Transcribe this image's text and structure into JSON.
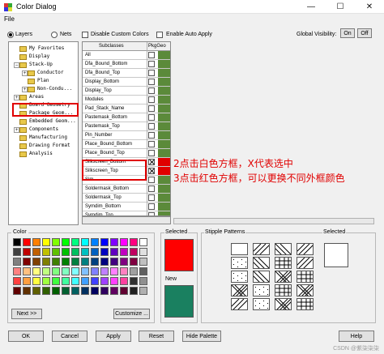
{
  "window": {
    "title": "Color Dialog",
    "min": "—",
    "max": "☐",
    "close": "✕"
  },
  "menu": {
    "file": "File"
  },
  "options": {
    "layers": "Layers",
    "nets": "Nets",
    "disable_custom_colors": "Disable Custom Colors",
    "enable_auto_apply": "Enable Auto Apply",
    "global_visibility": "Global Visibility:",
    "on": "On",
    "off": "Off"
  },
  "tree": [
    {
      "label": "My Favorites",
      "depth": 1,
      "expander": ""
    },
    {
      "label": "Display",
      "depth": 1,
      "expander": ""
    },
    {
      "label": "Stack-Up",
      "depth": 1,
      "expander": "−"
    },
    {
      "label": "Conductor",
      "depth": 2,
      "expander": "+"
    },
    {
      "label": "Plan",
      "depth": 2,
      "expander": ""
    },
    {
      "label": "Non-Condu...",
      "depth": 2,
      "expander": "+"
    },
    {
      "label": "Areas",
      "depth": 1,
      "expander": "+"
    },
    {
      "label": "Board Geometry",
      "depth": 1,
      "expander": ""
    },
    {
      "label": "Package Geom...",
      "depth": 1,
      "expander": ""
    },
    {
      "label": "Embedded Geom...",
      "depth": 1,
      "expander": ""
    },
    {
      "label": "Components",
      "depth": 1,
      "expander": "+"
    },
    {
      "label": "Manufacturing",
      "depth": 1,
      "expander": ""
    },
    {
      "label": "Drawing Format",
      "depth": 1,
      "expander": ""
    },
    {
      "label": "Analysis",
      "depth": 1,
      "expander": ""
    }
  ],
  "subclasses": {
    "col_name": "Subclasses",
    "col_pkg": "PkgGeo",
    "rows": [
      {
        "name": "All",
        "checked": false,
        "color": "#5b8a3a"
      },
      {
        "name": "Dfa_Bound_Bottom",
        "checked": false,
        "color": "#5b8a3a"
      },
      {
        "name": "Dfa_Bound_Top",
        "checked": false,
        "color": "#5b8a3a"
      },
      {
        "name": "Display_Bottom",
        "checked": false,
        "color": "#5b8a3a"
      },
      {
        "name": "Display_Top",
        "checked": false,
        "color": "#5b8a3a"
      },
      {
        "name": "Modules",
        "checked": false,
        "color": "#5b8a3a"
      },
      {
        "name": "Pad_Stack_Name",
        "checked": false,
        "color": "#5b8a3a"
      },
      {
        "name": "Pastemask_Bottom",
        "checked": false,
        "color": "#5b8a3a"
      },
      {
        "name": "Pastemask_Top",
        "checked": false,
        "color": "#5b8a3a"
      },
      {
        "name": "Pin_Number",
        "checked": false,
        "color": "#5b8a3a"
      },
      {
        "name": "Place_Bound_Bottom",
        "checked": false,
        "color": "#5b8a3a"
      },
      {
        "name": "Place_Bound_Top",
        "checked": false,
        "color": "#5b8a3a"
      },
      {
        "name": "Silkscreen_Bottom",
        "checked": true,
        "color": "#e00000"
      },
      {
        "name": "Silkscreen_Top",
        "checked": true,
        "color": "#e00000"
      },
      {
        "name": "Sim",
        "checked": false,
        "color": "#5b8a3a"
      },
      {
        "name": "Soldermask_Bottom",
        "checked": false,
        "color": "#5b8a3a"
      },
      {
        "name": "Soldermask_Top",
        "checked": false,
        "color": "#5b8a3a"
      },
      {
        "name": "Symdim_Bottom",
        "checked": false,
        "color": "#5b8a3a"
      },
      {
        "name": "Symdim_Top",
        "checked": false,
        "color": "#5b8a3a"
      }
    ]
  },
  "annotations": {
    "line1": "2点击白色方框，X代表选中",
    "line2": "3点击红色方框，可以更换不同外框颜色"
  },
  "color_group": {
    "label": "Color",
    "next": "Next >>",
    "customize": "Customize ..."
  },
  "palette": [
    [
      "#000000",
      "#ff0000",
      "#ff8000",
      "#ffff00",
      "#80ff00",
      "#00ff00",
      "#00ff80",
      "#00ffff",
      "#0080ff",
      "#0000ff",
      "#8000ff",
      "#ff00ff",
      "#ff0080",
      "#ffffff"
    ],
    [
      "#404040",
      "#c00000",
      "#c06000",
      "#c0c000",
      "#60c000",
      "#00c000",
      "#00c060",
      "#00c0c0",
      "#0060c0",
      "#0000c0",
      "#6000c0",
      "#c000c0",
      "#c00060",
      "#e0e0e0"
    ],
    [
      "#808080",
      "#800000",
      "#804000",
      "#808000",
      "#408000",
      "#008000",
      "#008040",
      "#008080",
      "#004080",
      "#000080",
      "#400080",
      "#800080",
      "#800040",
      "#c0c0c0"
    ],
    [
      "#ff8080",
      "#ffc080",
      "#ffff80",
      "#c0ff80",
      "#80ff80",
      "#80ffc0",
      "#80ffff",
      "#80c0ff",
      "#8080ff",
      "#c080ff",
      "#ff80ff",
      "#ff80c0",
      "#a0a0a0",
      "#606060"
    ],
    [
      "#ff4040",
      "#ff9f40",
      "#ffff40",
      "#9fff40",
      "#40ff40",
      "#40ff9f",
      "#40ffff",
      "#409fff",
      "#4040ff",
      "#9f40ff",
      "#ff40ff",
      "#ff409f",
      "#303030",
      "#909090"
    ],
    [
      "#600000",
      "#603000",
      "#606000",
      "#306000",
      "#006000",
      "#006030",
      "#006060",
      "#003060",
      "#000060",
      "#300060",
      "#600060",
      "#600030",
      "#202020",
      "#b0b0b0"
    ]
  ],
  "selected": {
    "label": "Selected",
    "color": "#ff0000"
  },
  "new": {
    "label": "New",
    "color": "#1a8060"
  },
  "stipple": {
    "label": "Stipple Patterns",
    "selected_label": "Selected"
  },
  "buttons": {
    "ok": "OK",
    "cancel": "Cancel",
    "apply": "Apply",
    "reset": "Reset",
    "hide_palette": "Hide Palette",
    "help": "Help"
  },
  "watermark": "CSDN @紫柒柒柒"
}
